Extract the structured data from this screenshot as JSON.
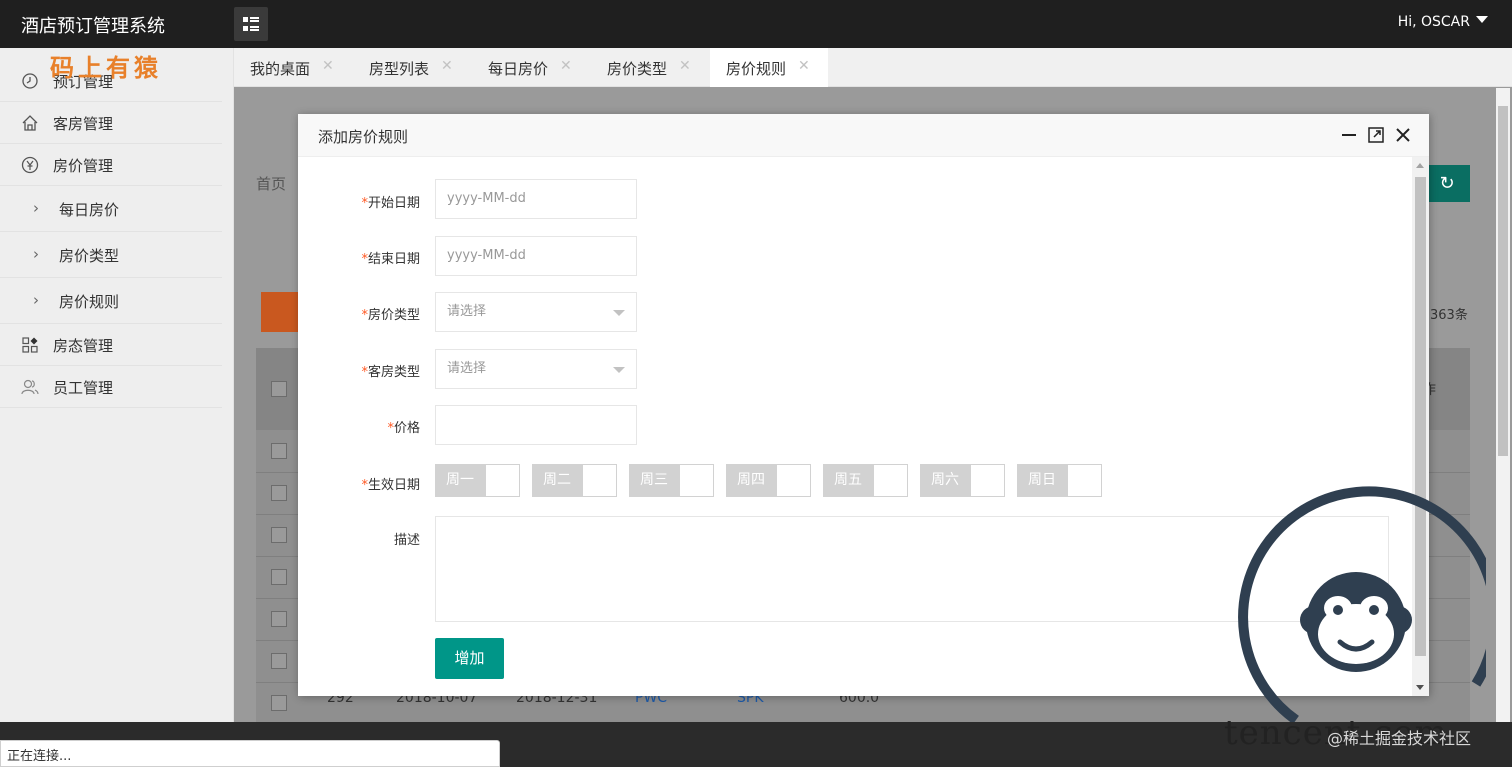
{
  "header": {
    "app_title": "酒店预订管理系统",
    "user_greeting": "Hi, OSCAR"
  },
  "watermarks": {
    "top_logo_text": "码上有猿",
    "bottom_juejin": "@稀土掘金技术社区",
    "bottom_tencent": "tencent.com"
  },
  "sidebar": {
    "items": [
      {
        "label": "预订管理",
        "icon": "clock-icon"
      },
      {
        "label": "客房管理",
        "icon": "home-icon"
      },
      {
        "label": "房价管理",
        "icon": "yen-icon"
      },
      {
        "label": "房态管理",
        "icon": "apps-icon"
      },
      {
        "label": "员工管理",
        "icon": "users-icon"
      }
    ],
    "sub_items": [
      {
        "label": "每日房价"
      },
      {
        "label": "房价类型"
      },
      {
        "label": "房价规则"
      }
    ]
  },
  "tabs": [
    {
      "label": "我的桌面"
    },
    {
      "label": "房型列表"
    },
    {
      "label": "每日房价"
    },
    {
      "label": "房价类型"
    },
    {
      "label": "房价规则",
      "active": true
    }
  ],
  "background_page": {
    "breadcrumb": "首页",
    "count_text": "363条",
    "op_column_label": "作",
    "last_row": {
      "id": "292",
      "start_date": "2018-10-07",
      "end_date": "2018-12-31",
      "price_type": "PWC",
      "room_type": "SPK",
      "price": "600.0"
    }
  },
  "dialog": {
    "title": "添加房价规则",
    "fields": {
      "start_date": {
        "label": "开始日期",
        "required": true,
        "placeholder": "yyyy-MM-dd"
      },
      "end_date": {
        "label": "结束日期",
        "required": true,
        "placeholder": "yyyy-MM-dd"
      },
      "price_type": {
        "label": "房价类型",
        "required": true,
        "placeholder": "请选择"
      },
      "room_type": {
        "label": "客房类型",
        "required": true,
        "placeholder": "请选择"
      },
      "price": {
        "label": "价格",
        "required": true,
        "value": ""
      },
      "effective_days": {
        "label": "生效日期",
        "required": true,
        "days": [
          "周一",
          "周二",
          "周三",
          "周四",
          "周五",
          "周六",
          "周日"
        ]
      },
      "description": {
        "label": "描述",
        "required": false,
        "value": ""
      }
    },
    "submit_label": "增加"
  },
  "status": {
    "text": "正在连接..."
  },
  "colors": {
    "primary": "#009688",
    "required_mark": "#ff5722",
    "topbar": "#1f1f1f",
    "delete_button": "#c9581f"
  }
}
